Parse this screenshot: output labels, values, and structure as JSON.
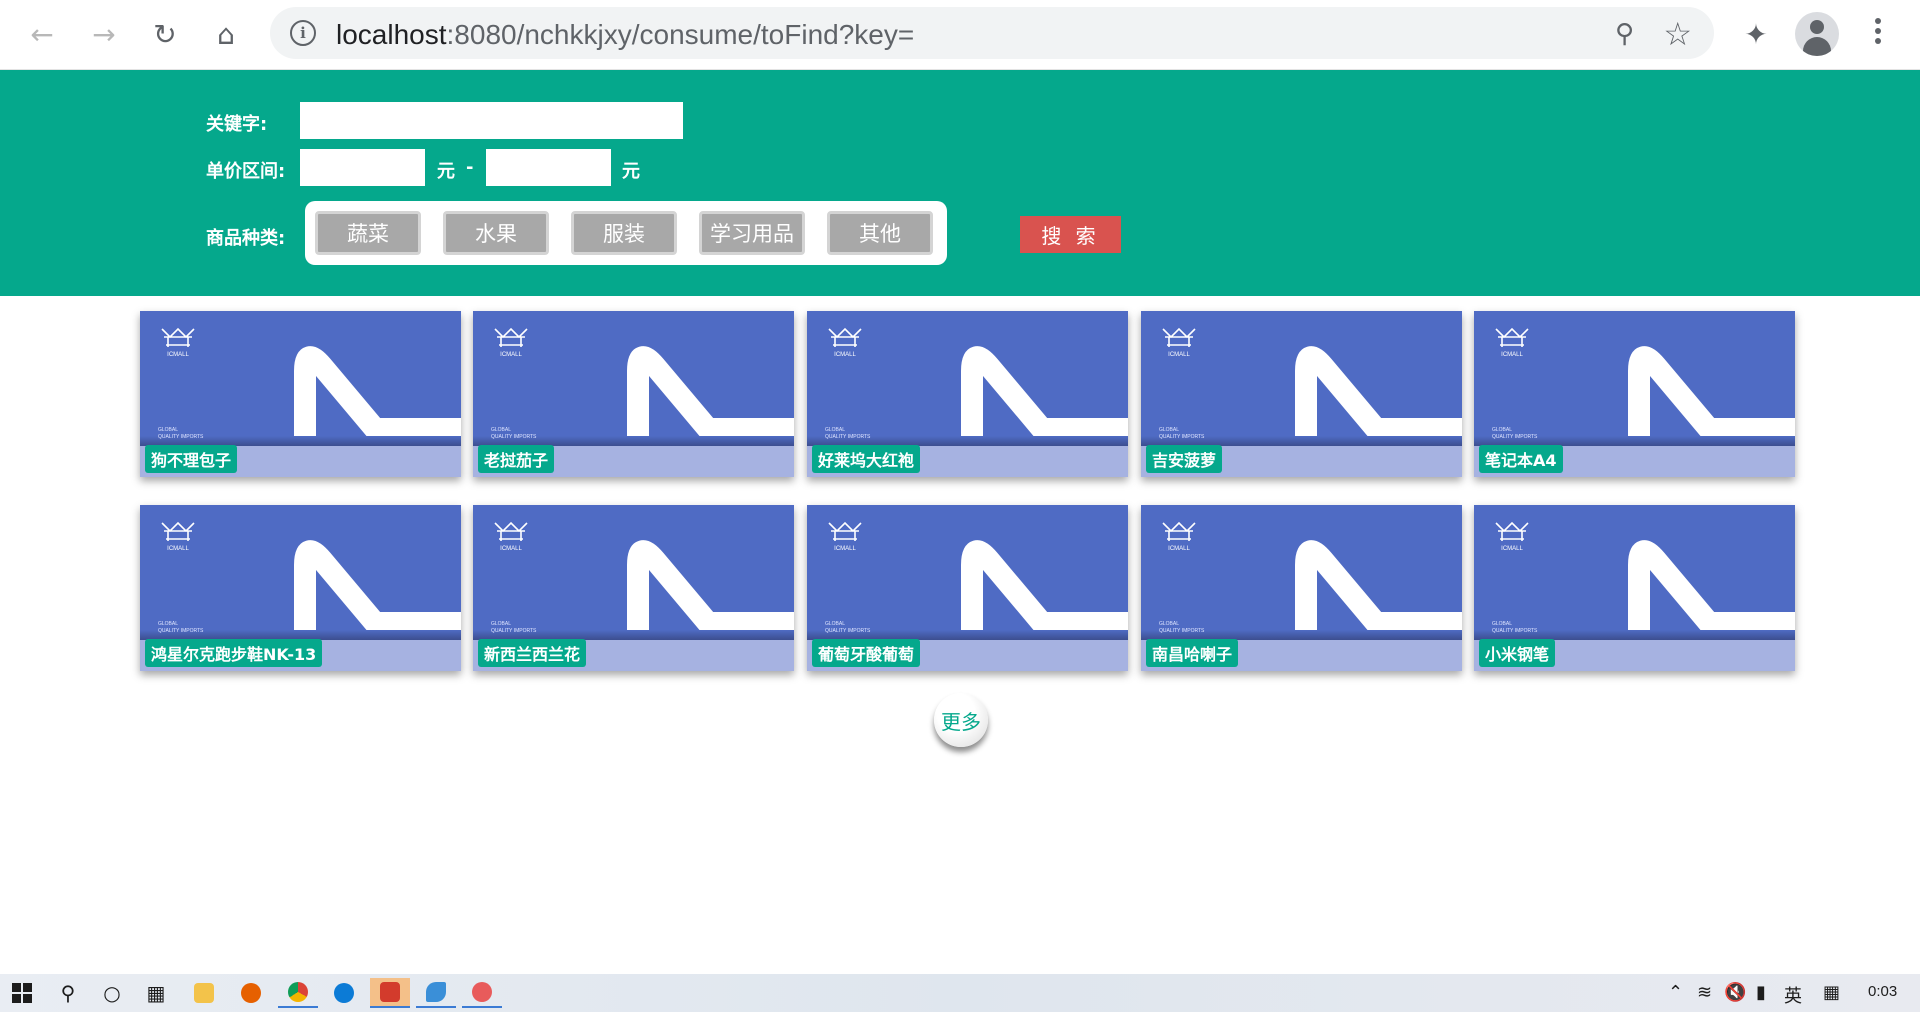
{
  "browser": {
    "url_host": "localhost",
    "url_rest": ":8080/nchkkjxy/consume/toFind?key="
  },
  "filters": {
    "keyword_label": "关键字:",
    "keyword_value": "",
    "price_label": "单价区间:",
    "price_min": "",
    "price_max": "",
    "unit": "元",
    "dash": "-",
    "category_label": "商品种类:",
    "categories": [
      "蔬菜",
      "水果",
      "服装",
      "学习用品",
      "其他"
    ],
    "search_label": "搜 索"
  },
  "products": [
    {
      "name": "狗不理包子"
    },
    {
      "name": "老挝茄子"
    },
    {
      "name": "好莱坞大红袍"
    },
    {
      "name": "吉安菠萝"
    },
    {
      "name": "笔记本A4"
    },
    {
      "name": "鸿星尔克跑步鞋NK-13"
    },
    {
      "name": "新西兰西兰花"
    },
    {
      "name": "葡萄牙酸葡萄"
    },
    {
      "name": "南昌哈喇子"
    },
    {
      "name": "小米钢笔"
    }
  ],
  "card_logo_text": "ICMALL",
  "card_small_text": [
    "GLOBAL",
    "QUALITY IMPORTS"
  ],
  "more_label": "更多",
  "taskbar": {
    "ime": "英",
    "time": "0:03"
  },
  "colors": {
    "header_green": "#05a88c",
    "card_blue": "#4f6bc4",
    "search_red": "#d9534f"
  }
}
